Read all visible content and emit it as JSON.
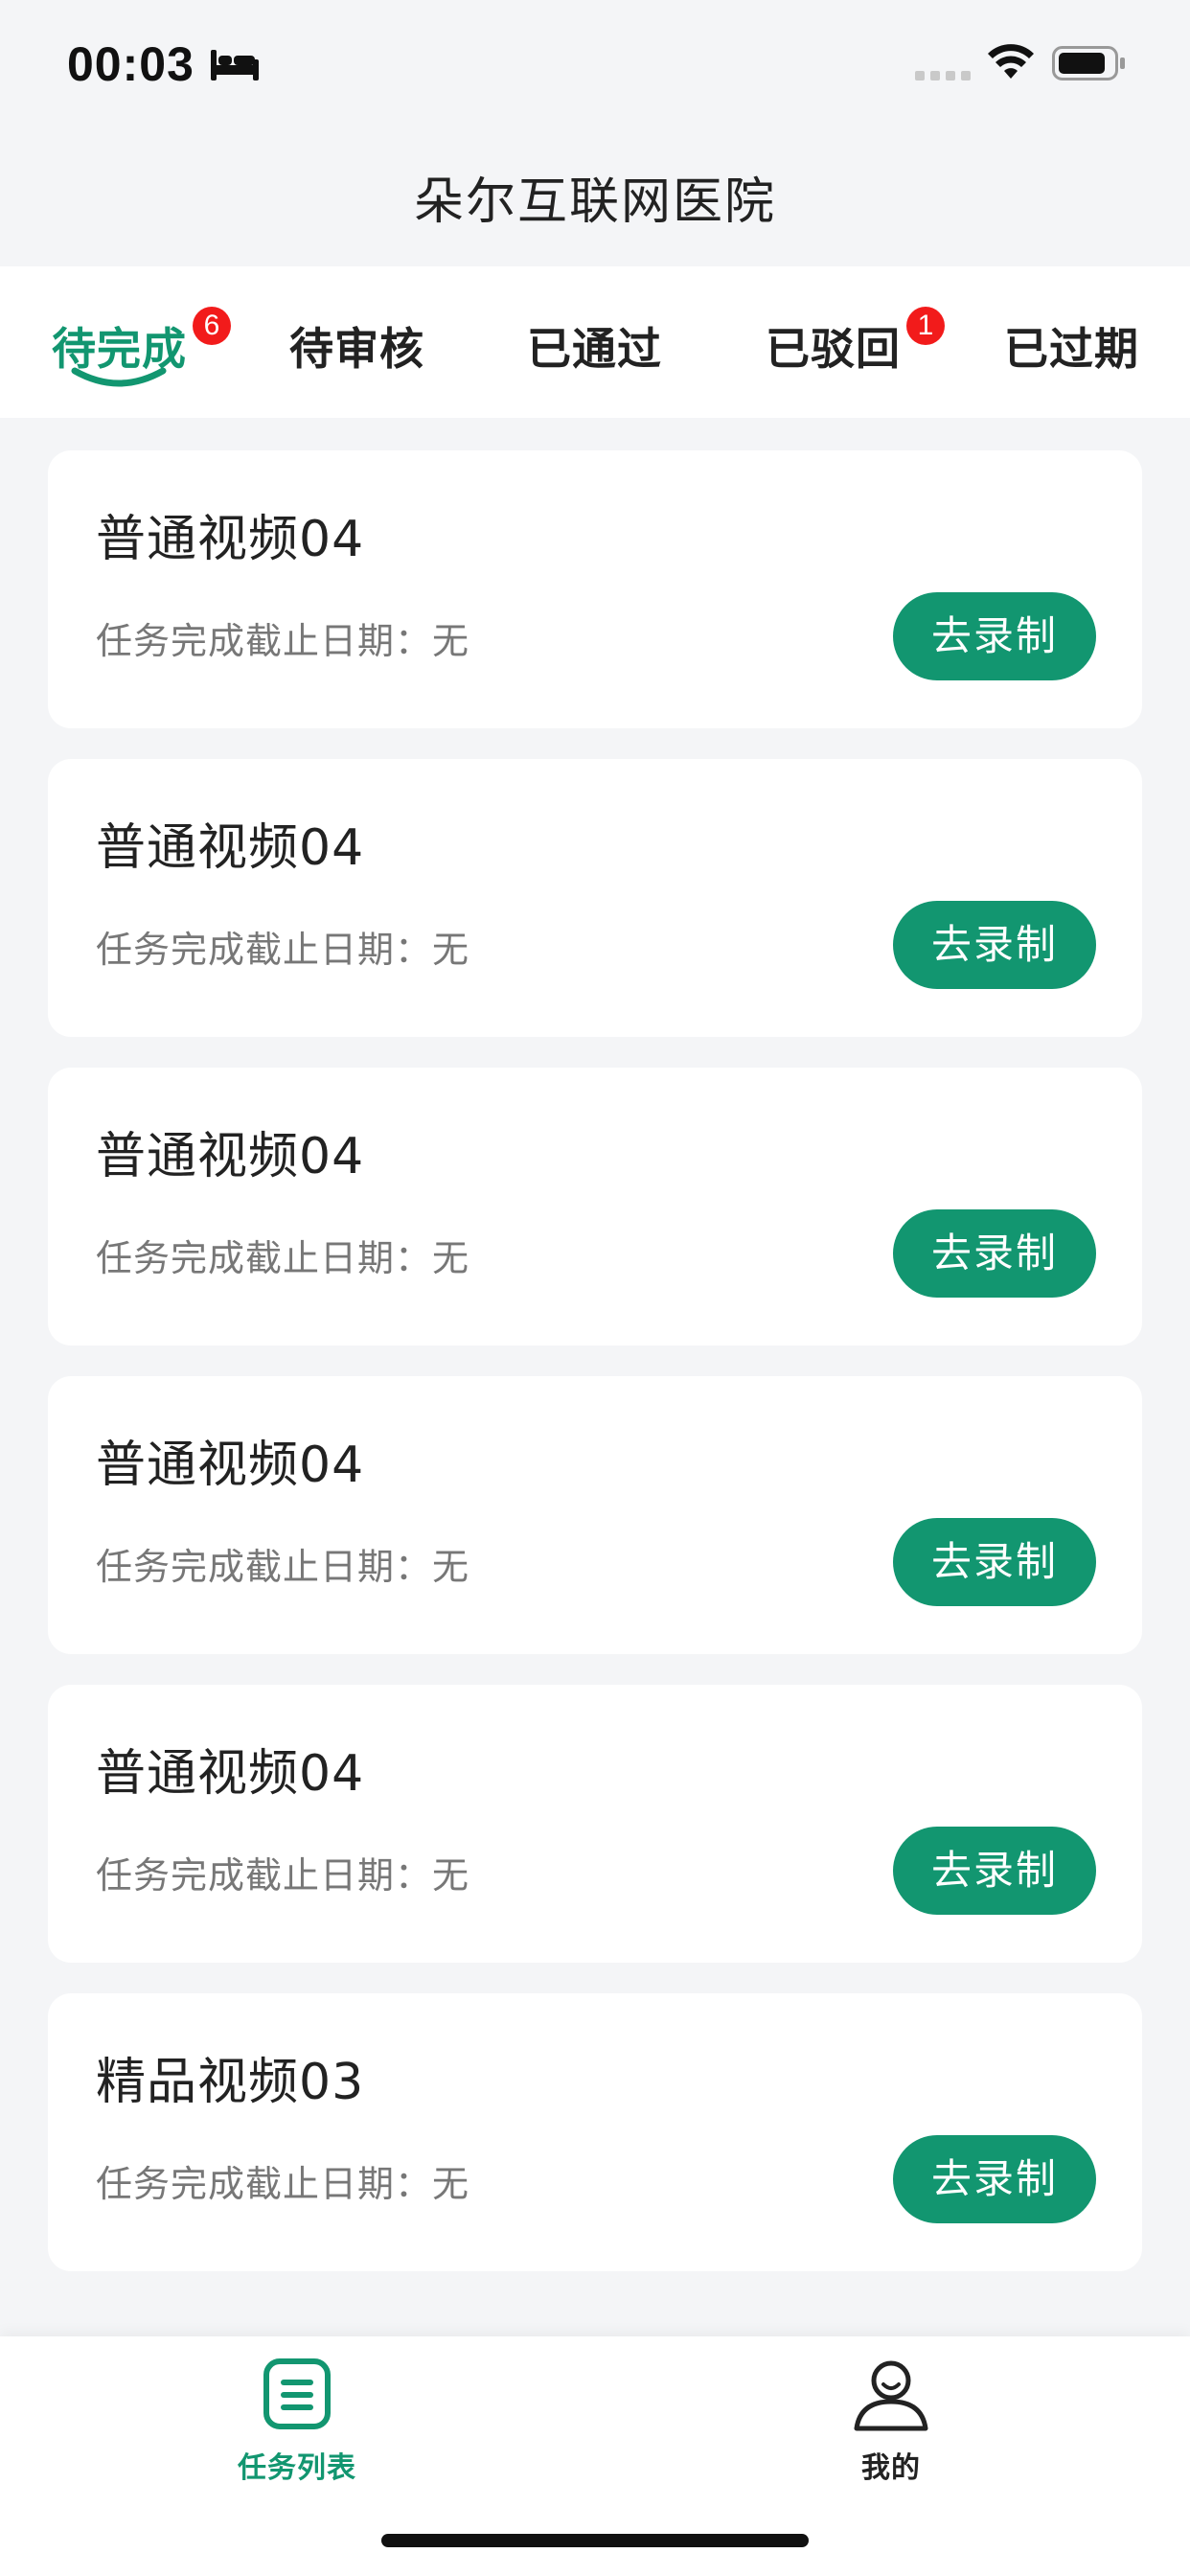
{
  "status_bar": {
    "time": "00:03",
    "icons": [
      "bed-icon",
      "cellular-signal-icon",
      "wifi-icon",
      "battery-icon"
    ]
  },
  "nav": {
    "title": "朵尔互联网医院"
  },
  "tabs": [
    {
      "label": "待完成",
      "badge": "6",
      "active": true
    },
    {
      "label": "待审核",
      "badge": "",
      "active": false
    },
    {
      "label": "已通过",
      "badge": "",
      "active": false
    },
    {
      "label": "已驳回",
      "badge": "1",
      "active": false
    },
    {
      "label": "已过期",
      "badge": "",
      "active": false
    }
  ],
  "tasks": [
    {
      "title": "普通视频04",
      "deadline": "任务完成截止日期：无",
      "button": "去录制"
    },
    {
      "title": "普通视频04",
      "deadline": "任务完成截止日期：无",
      "button": "去录制"
    },
    {
      "title": "普通视频04",
      "deadline": "任务完成截止日期：无",
      "button": "去录制"
    },
    {
      "title": "普通视频04",
      "deadline": "任务完成截止日期：无",
      "button": "去录制"
    },
    {
      "title": "普通视频04",
      "deadline": "任务完成截止日期：无",
      "button": "去录制"
    },
    {
      "title": "精品视频03",
      "deadline": "任务完成截止日期：无",
      "button": "去录制"
    }
  ],
  "tabbar": [
    {
      "label": "任务列表",
      "icon": "task-list-icon",
      "active": true
    },
    {
      "label": "我的",
      "icon": "profile-icon",
      "active": false
    }
  ],
  "colors": {
    "accent": "#129670",
    "badge": "#f21b1b",
    "background": "#f4f5f7"
  }
}
